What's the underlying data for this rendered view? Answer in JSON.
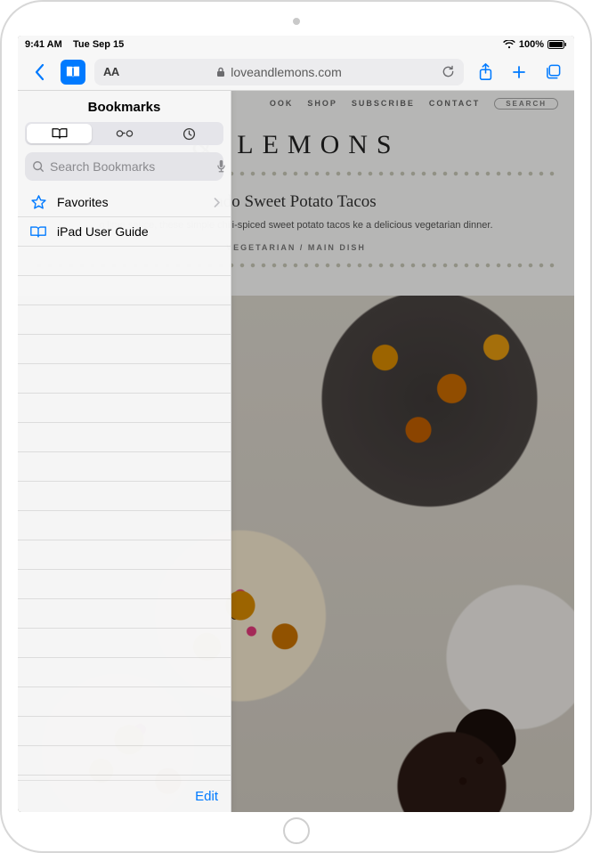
{
  "statusbar": {
    "time": "9:41 AM",
    "date": "Tue Sep 15",
    "battery_pct": "100%"
  },
  "toolbar": {
    "aa_label": "AA",
    "url": "loveandlemons.com"
  },
  "sidebar": {
    "title": "Bookmarks",
    "search_placeholder": "Search Bookmarks",
    "edit_label": "Edit",
    "items": [
      {
        "label": "Favorites",
        "icon": "star",
        "has_chevron": true
      },
      {
        "label": "iPad User Guide",
        "icon": "book",
        "has_chevron": false
      }
    ]
  },
  "page": {
    "nav_items": [
      "OOK",
      "SHOP",
      "SUBSCRIBE",
      "CONTACT"
    ],
    "nav_search_label": "SEARCH",
    "brand_fragment": "& LEMONS",
    "recipe_title_fragment": "ado Sweet Potato Tacos",
    "blurb_fragment": "o lime sauce, these simple chili-spiced sweet potato tacos ke a delicious vegetarian dinner.",
    "categories": "VEGETARIAN / MAIN DISH"
  }
}
